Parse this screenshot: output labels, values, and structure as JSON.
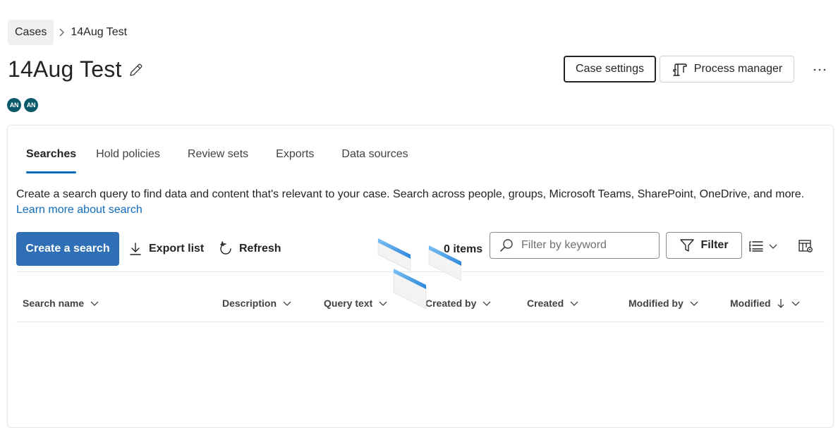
{
  "breadcrumb": {
    "root": "Cases",
    "current": "14Aug Test"
  },
  "page": {
    "title": "14Aug Test"
  },
  "header_actions": {
    "case_settings": "Case settings",
    "process_manager": "Process manager"
  },
  "avatars": [
    "AN",
    "AN"
  ],
  "tabs": [
    "Searches",
    "Hold policies",
    "Review sets",
    "Exports",
    "Data sources"
  ],
  "active_tab": "Searches",
  "description": {
    "text": "Create a search query to find data and content that's relevant to your case. Search across people, groups, Microsoft Teams, SharePoint, OneDrive, and more.",
    "link": "Learn more about search"
  },
  "toolbar": {
    "create": "Create a search",
    "export": "Export list",
    "refresh": "Refresh",
    "items_count": "0 items",
    "filter_placeholder": "Filter by keyword",
    "filter": "Filter"
  },
  "table": {
    "columns": [
      "Search name",
      "Description",
      "Query text",
      "Created by",
      "Created",
      "Modified by",
      "Modified"
    ],
    "sorted_column": "Modified",
    "sort_direction": "descending",
    "rows": []
  },
  "colors": {
    "accent": "#0f6cbd",
    "primary_button": "#2f6fb6",
    "avatar": "#0b5a6b"
  }
}
